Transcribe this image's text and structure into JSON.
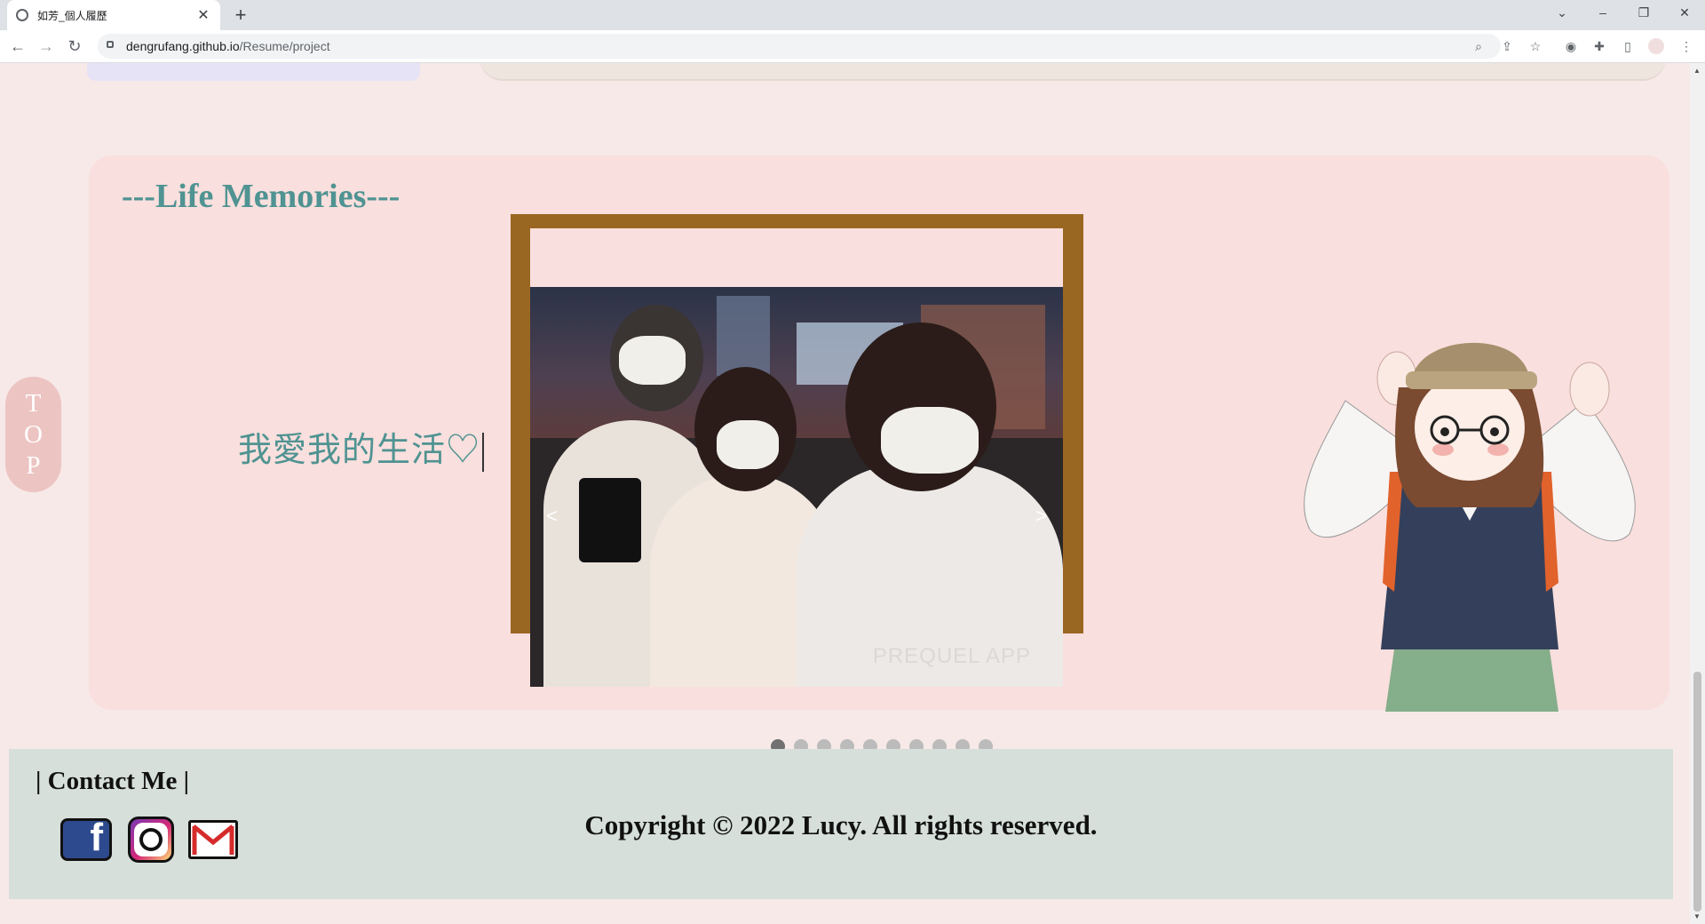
{
  "browser": {
    "tab_title": "如芳_個人履歷",
    "new_tab_symbol": "+",
    "url_host": "dengrufang.github.io",
    "url_path": "/Resume/project"
  },
  "page": {
    "section_title": "---Life Memories---",
    "love_text": "我愛我的生活♡",
    "top_button": [
      "T",
      "O",
      "P"
    ],
    "carousel": {
      "prev_label": "<",
      "next_label": ">",
      "watermark": "PREQUEL APP",
      "slide_count": 10,
      "active_index": 0
    },
    "footer": {
      "contact_heading": "| Contact Me |",
      "copyright": "Copyright © 2022 Lucy. All rights reserved.",
      "social": [
        "facebook",
        "instagram",
        "gmail"
      ]
    }
  },
  "colors": {
    "accent_teal": "#4f9392",
    "card_pink": "#f9dfdd",
    "frame_brown": "#9a6722",
    "footer_bg": "#d6dfda"
  }
}
